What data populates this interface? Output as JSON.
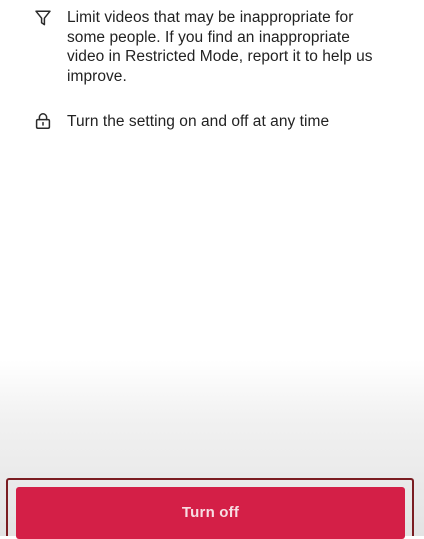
{
  "info_items": [
    {
      "icon": "filter-icon",
      "text": "Limit videos that may be inappropriate for some people. If you find an inappropriate video in Restricted Mode, report it to help us improve."
    },
    {
      "icon": "lock-icon",
      "text": "Turn the setting on and off at any time"
    }
  ],
  "primary_action": {
    "label": "Turn off"
  },
  "colors": {
    "accent": "#d41f47",
    "button_text": "#f7dde3",
    "body_text": "#222222",
    "icon_stroke": "#2a2a2a",
    "focus_frame": "#7a1d22"
  }
}
